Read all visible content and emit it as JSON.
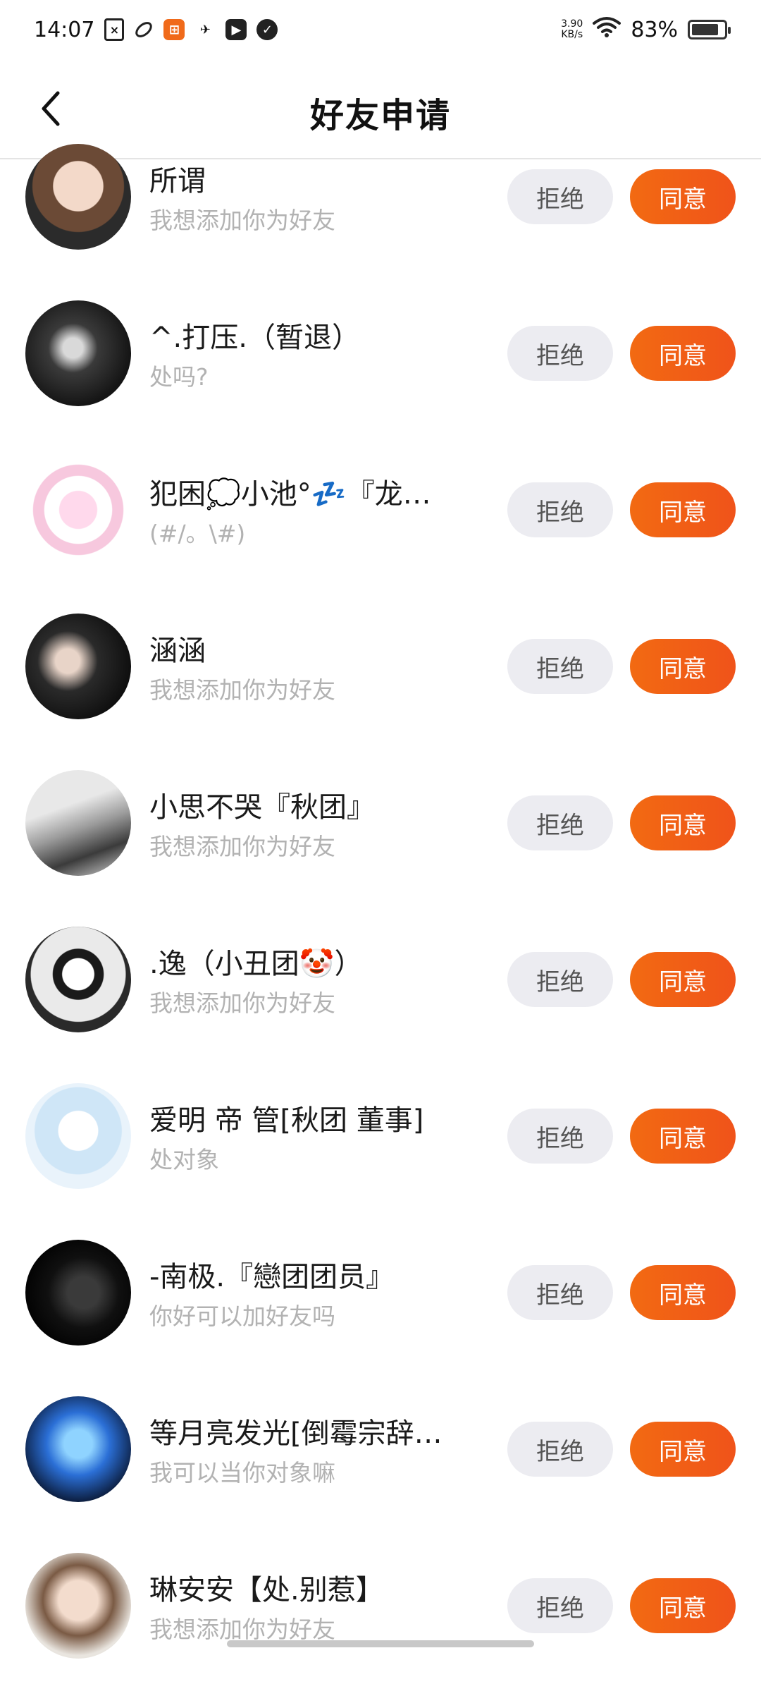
{
  "status_bar": {
    "time": "14:07",
    "net_speed_value": "3.90",
    "net_speed_unit": "KB/s",
    "battery": "83%",
    "battery_level": 0.83,
    "icons": [
      "document-icon",
      "leaf-icon",
      "app-orange-icon",
      "airplane-icon",
      "play-icon",
      "check-icon",
      "wifi-icon",
      "battery-icon"
    ]
  },
  "header": {
    "title": "好友申请",
    "back_icon": "chevron-left-icon"
  },
  "buttons": {
    "reject": "拒绝",
    "accept": "同意"
  },
  "colors": {
    "accent": "#F26A12",
    "reject_bg": "#ECECF1",
    "message_text": "#B2B2B2"
  },
  "requests": [
    {
      "name": "所谓",
      "message": "我想添加你为好友"
    },
    {
      "name": "^.打压.（暂退）",
      "message": "处吗?"
    },
    {
      "name": "犯困💭小池°💤『龙…",
      "message": "(#/。\\#)"
    },
    {
      "name": "涵涵",
      "message": "我想添加你为好友"
    },
    {
      "name": "小思不哭『秋团』",
      "message": "我想添加你为好友"
    },
    {
      "name": ".逸（小丑团🤡）",
      "message": "我想添加你为好友"
    },
    {
      "name": "爱明 帝 管[秋团 董事]",
      "message": "处对象"
    },
    {
      "name": "-南极.『戀团团员』",
      "message": "你好可以加好友吗"
    },
    {
      "name": "等月亮发光[倒霉宗辞…",
      "message": "我可以当你对象嘛"
    },
    {
      "name": "琳安安【处.别惹】",
      "message": "我想添加你为好友"
    }
  ]
}
